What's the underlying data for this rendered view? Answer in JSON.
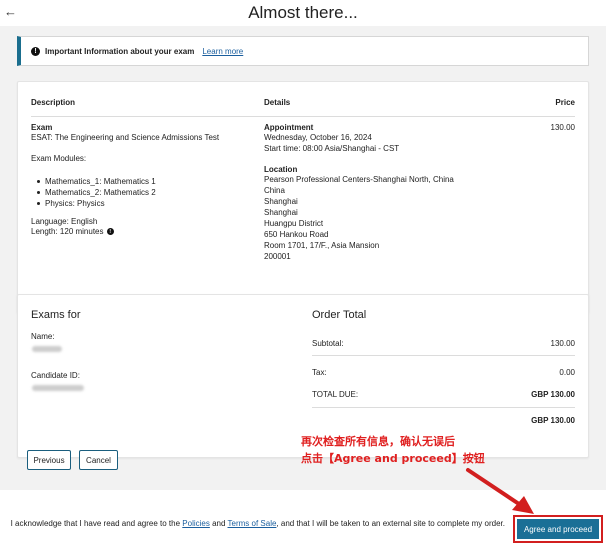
{
  "header": {
    "back_icon": "arrow-left-icon",
    "back_glyph": "←",
    "title": "Almost there..."
  },
  "info_banner": {
    "text": "Important Information about your exam",
    "link": "Learn more"
  },
  "details": {
    "headers": {
      "description": "Description",
      "details": "Details",
      "price": "Price"
    },
    "exam_label": "Exam",
    "exam_name": "ESAT: The Engineering and Science Admissions Test",
    "modules_label": "Exam Modules:",
    "modules": [
      "Mathematics_1: Mathematics 1",
      "Mathematics_2: Mathematics 2",
      "Physics: Physics"
    ],
    "language": "Language: English",
    "length": "Length: 120 minutes",
    "appointment_label": "Appointment",
    "appointment_date": "Wednesday, October 16, 2024",
    "start_time": "Start time: 08:00 Asia/Shanghai - CST",
    "location_label": "Location",
    "location_lines": [
      "Pearson Professional Centers-Shanghai North, China",
      "China",
      "Shanghai",
      "Shanghai",
      "Huangpu District",
      "650 Hankou Road",
      "Room 1701, 17/F., Asia Mansion",
      "200001"
    ],
    "price": "130.00"
  },
  "exams_for": {
    "title": "Exams for",
    "name_label": "Name:",
    "candidate_label": "Candidate ID:"
  },
  "order_total": {
    "title": "Order Total",
    "subtotal_label": "Subtotal:",
    "subtotal": "130.00",
    "tax_label": "Tax:",
    "tax": "0.00",
    "total_due_label": "TOTAL DUE:",
    "total_due": "GBP 130.00",
    "grand_total": "GBP 130.00"
  },
  "buttons": {
    "previous": "Previous",
    "cancel": "Cancel",
    "agree": "Agree and proceed"
  },
  "annotation": {
    "line1": "再次检查所有信息，确认无误后",
    "line2": "点击【Agree and proceed】按钮",
    "color": "#e02020"
  },
  "footer": {
    "pre": "I acknowledge that I have read and agree to the ",
    "policies": "Policies",
    "and": " and ",
    "terms": "Terms of Sale",
    "post": ", and that I will be taken to an external site to complete my order."
  }
}
